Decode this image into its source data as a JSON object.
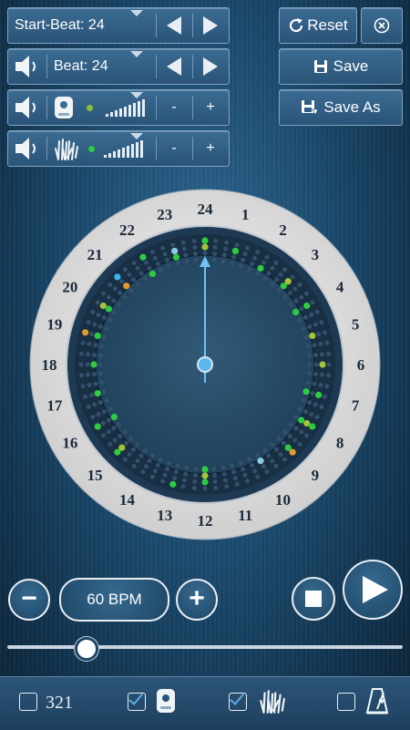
{
  "start_beat": {
    "label": "Start-Beat: 24"
  },
  "beat": {
    "label": "Beat: 24"
  },
  "track1": {
    "minus": "-",
    "plus": "+",
    "dot_color": "#8bbf3a"
  },
  "track2": {
    "minus": "-",
    "plus": "+",
    "dot_color": "#2ecc40"
  },
  "actions": {
    "reset": "Reset",
    "save": "Save",
    "save_as": "Save As"
  },
  "dial": {
    "numbers": [
      "24",
      "1",
      "2",
      "3",
      "4",
      "5",
      "6",
      "7",
      "8",
      "9",
      "10",
      "11",
      "12",
      "13",
      "14",
      "15",
      "16",
      "17",
      "18",
      "19",
      "20",
      "21",
      "22",
      "23"
    ],
    "colors": {
      "green": "#2ecc40",
      "olive": "#a5c23a",
      "orange": "#e59a2b",
      "lightblue": "#8ecae6",
      "cyan": "#38b6e8"
    }
  },
  "tempo": {
    "bpm": "60 BPM",
    "minus": "−",
    "plus": "+",
    "slider_fraction": 0.2
  },
  "footer": {
    "count_label": "321",
    "count_checked": false,
    "metro_checked": true,
    "clap_checked": true,
    "pendulum_checked": false
  }
}
